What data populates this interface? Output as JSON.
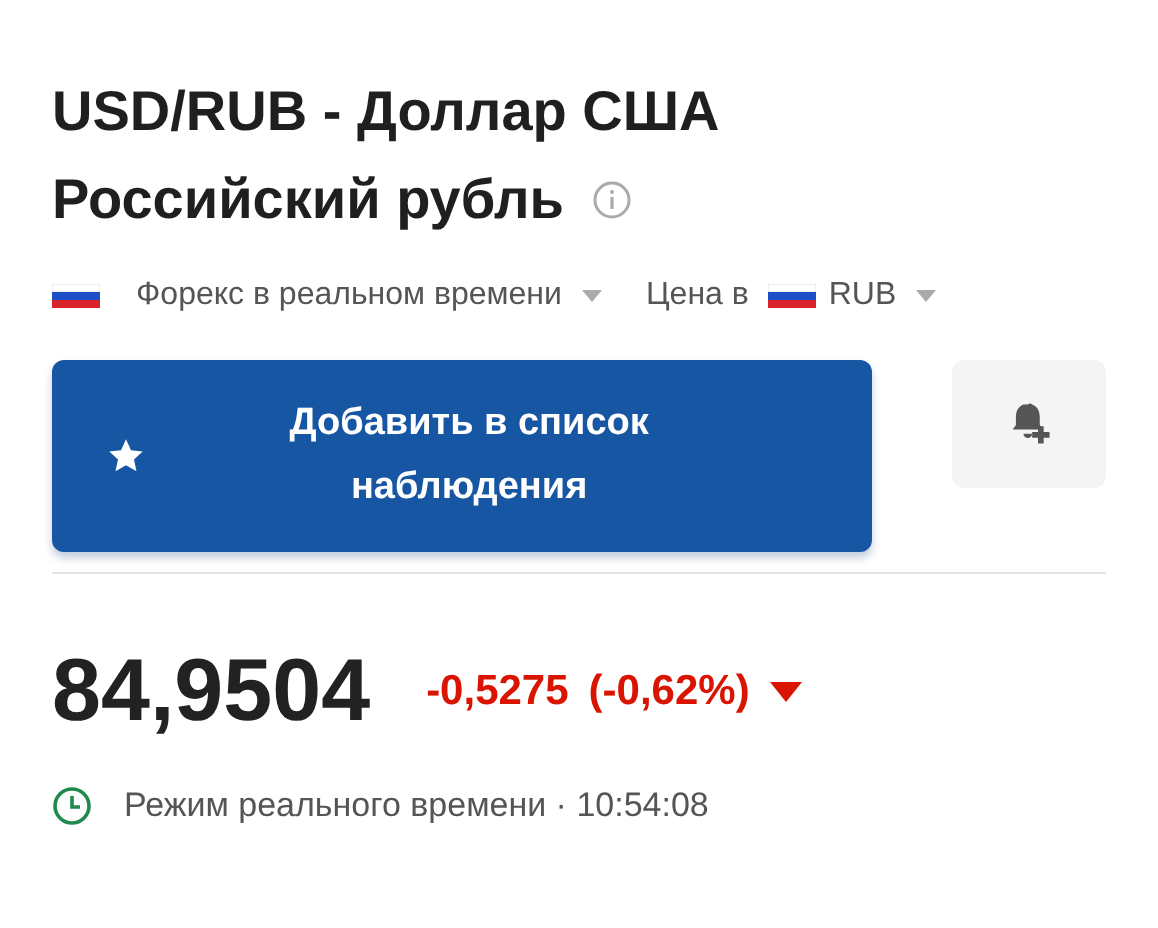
{
  "instrument": {
    "title": "USD/RUB - Доллар США Российский рубль"
  },
  "selectors": [
    {
      "kind": "market",
      "label": "Форекс в реальном времени"
    },
    {
      "kind": "currency",
      "prefix": "Цена в",
      "label": "RUB"
    }
  ],
  "watchlist_button": {
    "label": "Добавить в список наблюдения"
  },
  "quote": {
    "price": "84,9504",
    "change": "-0,5275",
    "change_percent": "(-0,62%)",
    "falling": true
  },
  "status": {
    "text": "Режим реального времени · 10:54:08"
  }
}
